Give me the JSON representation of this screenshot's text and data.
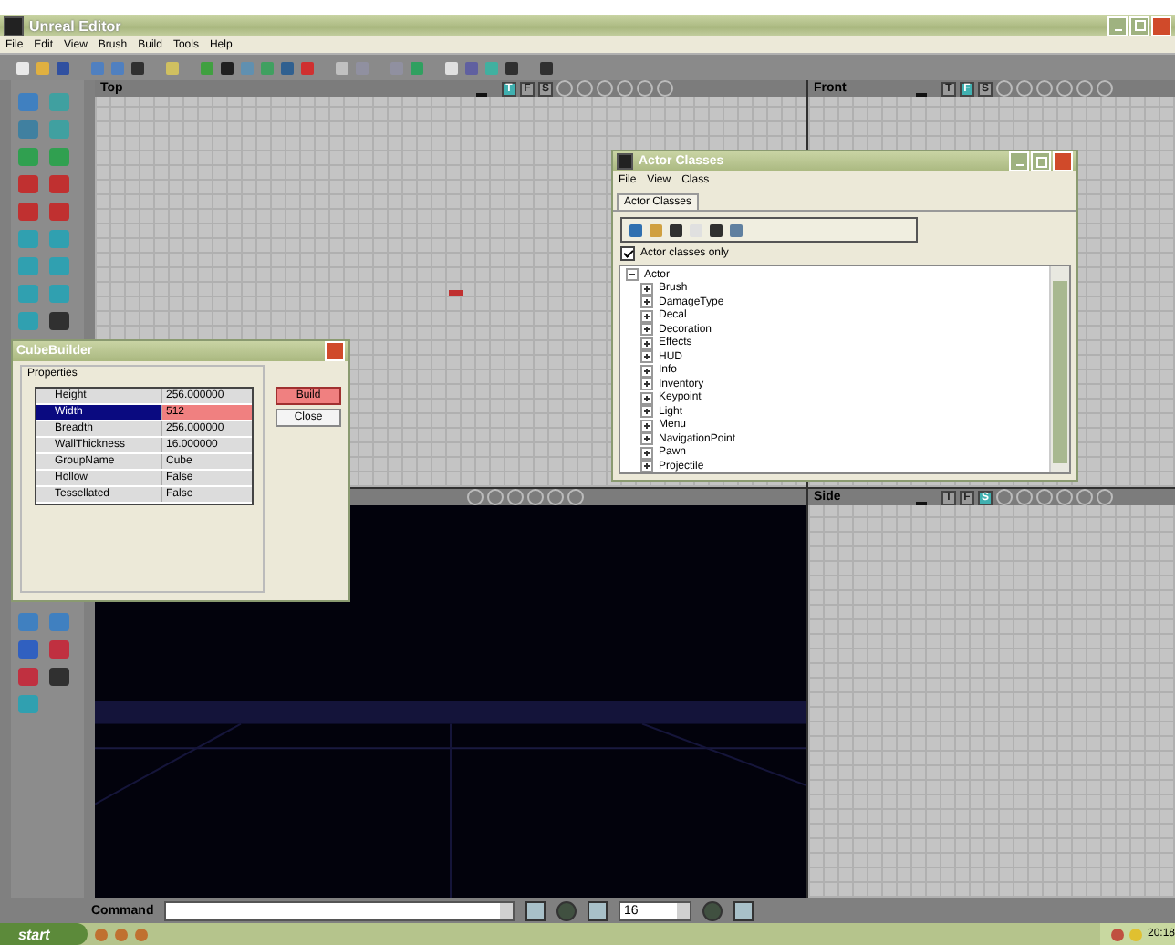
{
  "window": {
    "title": "Unreal Editor"
  },
  "menu": [
    "File",
    "Edit",
    "View",
    "Brush",
    "Build",
    "Tools",
    "Help"
  ],
  "viewports": [
    {
      "label": "Top",
      "kind": "grid",
      "views": [
        {
          "label": "T",
          "selected": true
        },
        {
          "label": "F",
          "selected": false
        },
        {
          "label": "S",
          "selected": false
        }
      ]
    },
    {
      "label": "Front",
      "kind": "grid",
      "views": [
        {
          "label": "T",
          "selected": false
        },
        {
          "label": "F",
          "selected": true
        },
        {
          "label": "S",
          "selected": false
        }
      ]
    },
    {
      "kind": "perspective"
    },
    {
      "label": "Side",
      "kind": "grid",
      "views": [
        {
          "label": "T",
          "selected": false
        },
        {
          "label": "F",
          "selected": false
        },
        {
          "label": "S",
          "selected": true
        }
      ]
    }
  ],
  "command_bar": {
    "label": "Command",
    "grid_size": "16"
  },
  "cube_builder": {
    "title": "CubeBuilder",
    "group": "Properties",
    "rows": [
      {
        "name": "Height",
        "value": "256.000000",
        "selected": false
      },
      {
        "name": "Width",
        "value": "512",
        "selected": true
      },
      {
        "name": "Breadth",
        "value": "256.000000",
        "selected": false
      },
      {
        "name": "WallThickness",
        "value": "16.000000",
        "selected": false
      },
      {
        "name": "GroupName",
        "value": "Cube",
        "selected": false
      },
      {
        "name": "Hollow",
        "value": "False",
        "selected": false
      },
      {
        "name": "Tessellated",
        "value": "False",
        "selected": false
      }
    ],
    "buttons": [
      {
        "label": "Build",
        "default": true
      },
      {
        "label": "Close",
        "default": false
      }
    ]
  },
  "actor_classes": {
    "title": "Actor Classes",
    "menu": [
      "File",
      "View",
      "Class"
    ],
    "tab": "Actor Classes",
    "filter": {
      "label": "Actor classes only",
      "checked": true
    },
    "tree": [
      {
        "label": "Actor",
        "expanded": true,
        "children": [
          {
            "label": "Brush",
            "expanded": false
          },
          {
            "label": "DamageType",
            "expanded": false
          },
          {
            "label": "Decal",
            "expanded": false
          },
          {
            "label": "Decoration",
            "expanded": false
          },
          {
            "label": "Effects",
            "expanded": false
          },
          {
            "label": "HUD",
            "expanded": false
          },
          {
            "label": "Info",
            "expanded": false
          },
          {
            "label": "Inventory",
            "expanded": false
          },
          {
            "label": "Keypoint",
            "expanded": false
          },
          {
            "label": "Light",
            "expanded": false
          },
          {
            "label": "Menu",
            "expanded": false
          },
          {
            "label": "NavigationPoint",
            "expanded": false
          },
          {
            "label": "Pawn",
            "expanded": false
          },
          {
            "label": "Projectile",
            "expanded": false
          }
        ]
      }
    ]
  },
  "taskbar": {
    "start": "start",
    "clock": "20:18"
  }
}
